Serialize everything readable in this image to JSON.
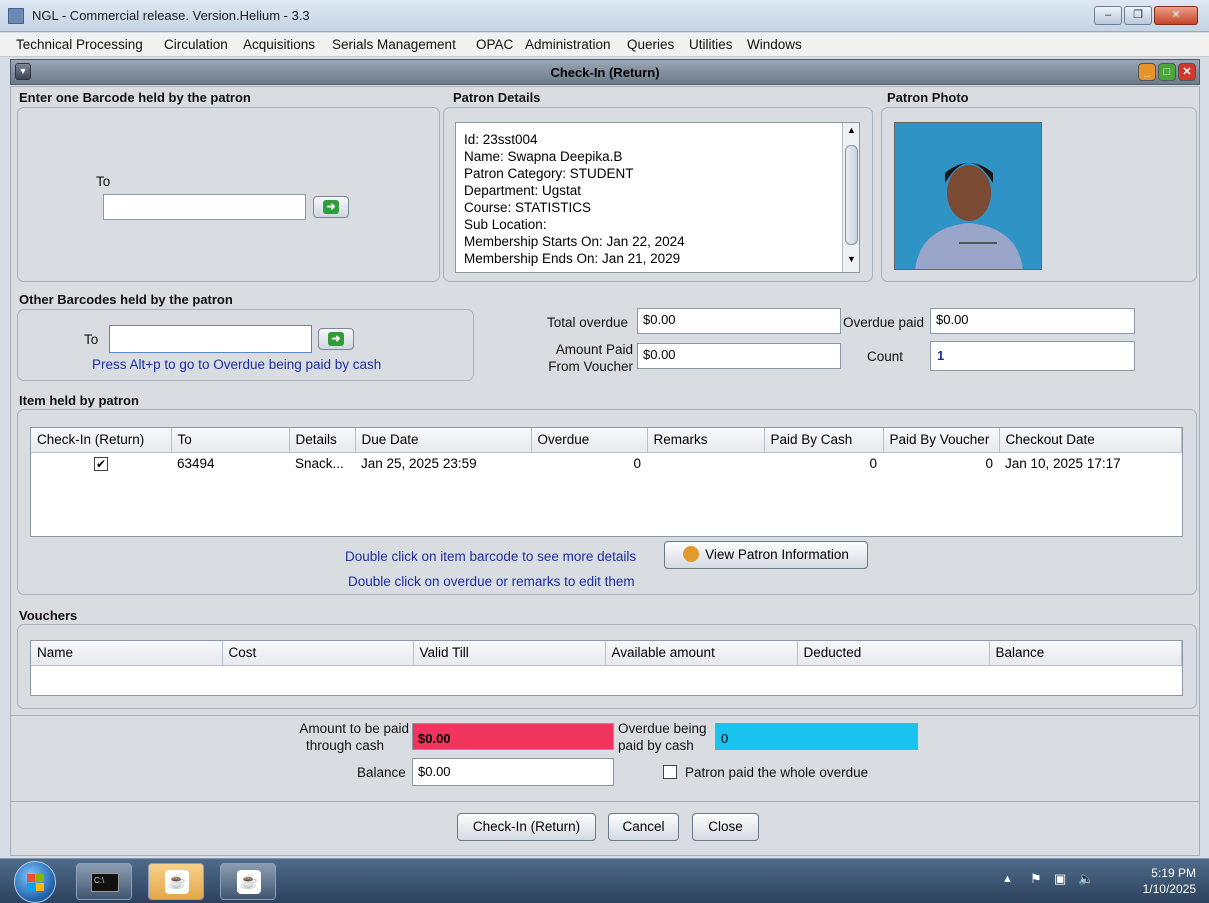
{
  "window": {
    "title": "NGL - Commercial release. Version.Helium - 3.3"
  },
  "menu": [
    "Technical Processing",
    "Circulation",
    "Acquisitions",
    "Serials Management",
    "OPAC",
    "Administration",
    "Queries",
    "Utilities",
    "Windows"
  ],
  "frame": {
    "title": "Check-In (Return)"
  },
  "barcode_section": {
    "title": "Enter one Barcode held by the patron",
    "to_label": "To",
    "value": ""
  },
  "patron_details": {
    "title": "Patron Details",
    "lines": [
      "Id: 23sst004",
      "Name: Swapna Deepika.B",
      "Patron Category: STUDENT",
      "Department: Ugstat",
      "Course: STATISTICS",
      "Sub Location:",
      "Membership Starts On: Jan 22, 2024",
      "Membership Ends On: Jan 21, 2029"
    ]
  },
  "patron_photo": {
    "title": "Patron Photo"
  },
  "other_barcodes": {
    "title": "Other Barcodes held by the patron",
    "to_label": "To",
    "value": "",
    "hint": "Press Alt+p to go to Overdue being paid by cash"
  },
  "overdue": {
    "total_label": "Total overdue",
    "total_value": "$0.00",
    "paid_label": "Overdue paid",
    "paid_value": "$0.00",
    "voucher_label_1": "Amount Paid",
    "voucher_label_2": "From Voucher",
    "voucher_value": "$0.00",
    "count_label": "Count",
    "count_value": "1"
  },
  "items": {
    "title": "Item held by patron",
    "columns": [
      "Check-In (Return)",
      "To",
      "Details",
      "Due Date",
      "Overdue",
      "Remarks",
      "Paid By Cash",
      "Paid By Voucher",
      "Checkout Date"
    ],
    "rows": [
      {
        "checked": true,
        "to": "63494",
        "details": "Snack...",
        "due": "Jan 25, 2025 23:59",
        "overdue": "0",
        "remarks": "",
        "cash": "0",
        "voucher": "0",
        "checkout": "Jan 10, 2025 17:17"
      }
    ],
    "hint1": "Double click on item barcode to see more details",
    "hint2": "Double click on overdue or remarks to edit them",
    "view_patron_button": "View Patron Information"
  },
  "vouchers": {
    "title": "Vouchers",
    "columns": [
      "Name",
      "Cost",
      "Valid Till",
      "Available amount",
      "Deducted",
      "Balance"
    ]
  },
  "payment": {
    "cash_label_1": "Amount to be paid",
    "cash_label_2": "through cash",
    "cash_value": "$0.00",
    "overdue_cash_label_1": "Overdue being",
    "overdue_cash_label_2": "paid by cash",
    "overdue_cash_value": "0",
    "balance_label": "Balance",
    "balance_value": "$0.00",
    "whole_overdue_label": "Patron paid the whole overdue"
  },
  "buttons": {
    "checkin": "Check-In (Return)",
    "cancel": "Cancel",
    "close": "Close"
  },
  "clock": {
    "time": "5:19 PM",
    "date": "1/10/2025"
  },
  "colors": {
    "cash_field": "#f0345e",
    "overdue_cash_field": "#19c2ef"
  }
}
